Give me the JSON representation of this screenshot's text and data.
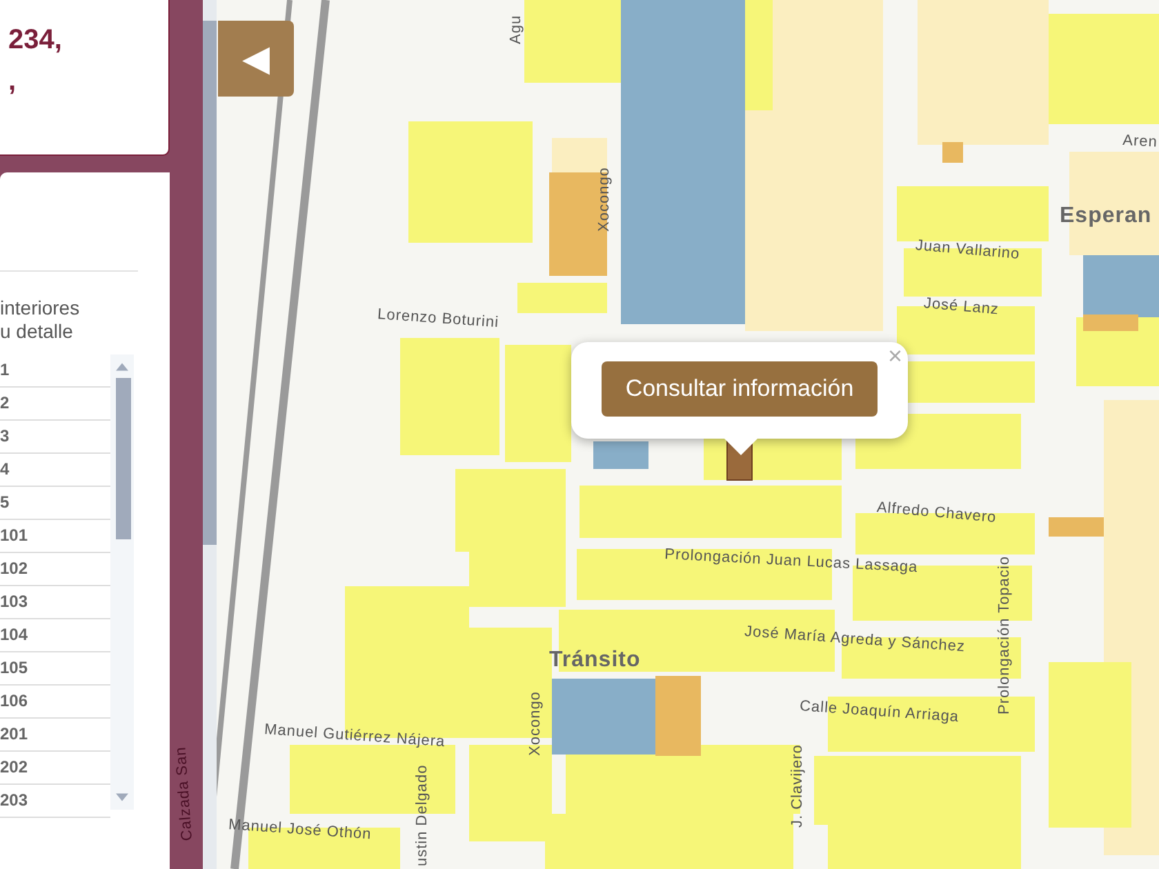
{
  "sidebar": {
    "address_card": {
      "lines": [
        "234,",
        ","
      ]
    },
    "units_card": {
      "description_lines": [
        "interiores",
        "u detalle"
      ],
      "units": [
        "1",
        "2",
        "3",
        "4",
        "5",
        "101",
        "102",
        "103",
        "104",
        "105",
        "106",
        "201",
        "202",
        "203"
      ]
    }
  },
  "map": {
    "back_button": {
      "icon": "◀"
    },
    "labels": [
      {
        "text": "Agu",
        "kind": "street"
      },
      {
        "text": "Xocongo",
        "kind": "street"
      },
      {
        "text": "Lorenzo  Boturini",
        "kind": "street"
      },
      {
        "text": "Juan Vallarino",
        "kind": "street"
      },
      {
        "text": "José Lanz",
        "kind": "street"
      },
      {
        "text": "Esperan",
        "kind": "district"
      },
      {
        "text": "Aren",
        "kind": "street"
      },
      {
        "text": "Alfredo Chavero",
        "kind": "street"
      },
      {
        "text": "Prolongación Juan Lucas Lassaga",
        "kind": "street"
      },
      {
        "text": "José María Agreda y Sánchez",
        "kind": "street"
      },
      {
        "text": "Tránsito",
        "kind": "district"
      },
      {
        "text": "Calle Joaquín Arriaga",
        "kind": "street"
      },
      {
        "text": "Manuel Gutiérrez Nájera",
        "kind": "street"
      },
      {
        "text": "Xocongo",
        "kind": "street"
      },
      {
        "text": "ustin Delgado",
        "kind": "street"
      },
      {
        "text": "Manuel José Othón",
        "kind": "street"
      },
      {
        "text": "J. Clavijero",
        "kind": "street"
      },
      {
        "text": "Prolongación Topacio",
        "kind": "street"
      },
      {
        "text": "Calzada San",
        "kind": "street"
      }
    ],
    "popup": {
      "button": "Consultar información",
      "close": "×"
    }
  }
}
